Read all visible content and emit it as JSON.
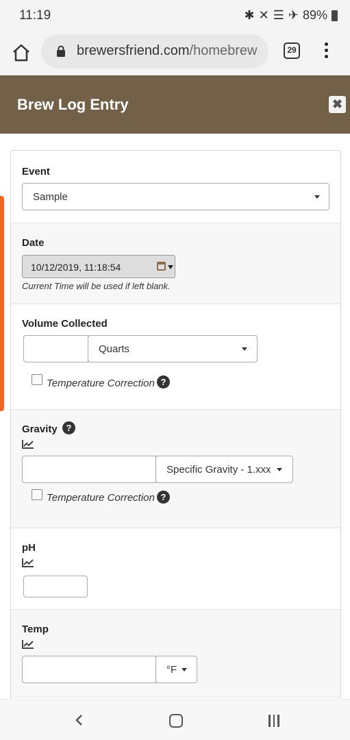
{
  "status_bar": {
    "time": "11:19",
    "battery": "89%",
    "icons": [
      "bluetooth-icon",
      "mute-icon",
      "wifi-icon",
      "airplane-icon",
      "battery-icon"
    ]
  },
  "browser": {
    "url_domain": "brewersfriend.com",
    "url_path": "/homebrew",
    "tab_count": "29"
  },
  "dialog": {
    "title": "Brew Log Entry",
    "close_glyph": "✖"
  },
  "form": {
    "event": {
      "label": "Event",
      "value": "Sample"
    },
    "date": {
      "label": "Date",
      "value": "10/12/2019, 11:18:54",
      "hint": "Current Time will be used if left blank."
    },
    "volume": {
      "label": "Volume Collected",
      "value": "",
      "unit": "Quarts",
      "temp_correction": "Temperature Correction"
    },
    "gravity": {
      "label": "Gravity",
      "value": "",
      "unit": "Specific Gravity - 1.xxx",
      "temp_correction": "Temperature Correction"
    },
    "ph": {
      "label": "pH",
      "value": ""
    },
    "temp": {
      "label": "Temp",
      "value": "",
      "unit": "°F"
    }
  },
  "colors": {
    "header": "#726148",
    "accent_tab": "#f26522"
  }
}
